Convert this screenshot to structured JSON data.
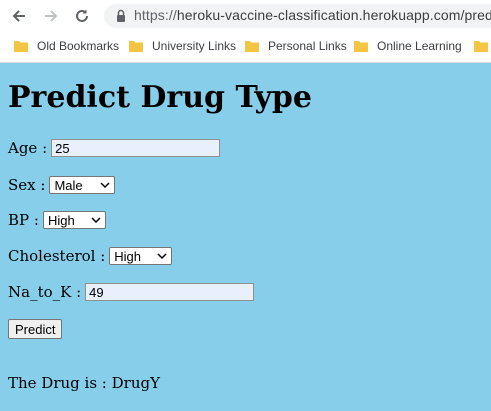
{
  "browser": {
    "url_scheme": "https://",
    "url_rest": "heroku-vaccine-classification.herokuapp.com/predict",
    "bookmarks": [
      "Old Bookmarks",
      "University Links",
      "Personal Links",
      "Online Learning"
    ],
    "icons": [
      "back-arrow-icon",
      "forward-arrow-icon",
      "reload-icon",
      "lock-icon",
      "folder-icon"
    ]
  },
  "page": {
    "title": "Predict Drug Type",
    "age_label": "Age :",
    "age_value": "25",
    "sex_label": "Sex :",
    "sex_value": "Male",
    "bp_label": "BP :",
    "bp_value": "High",
    "chol_label": "Cholesterol :",
    "chol_value": "High",
    "na_label": "Na_to_K :",
    "na_value": "49",
    "predict_label": "Predict",
    "result_text": "The Drug is : DrugY"
  },
  "colors": {
    "background": "#87ceeb",
    "input_fill": "#e8f0fe",
    "folder": "#f4c542"
  }
}
